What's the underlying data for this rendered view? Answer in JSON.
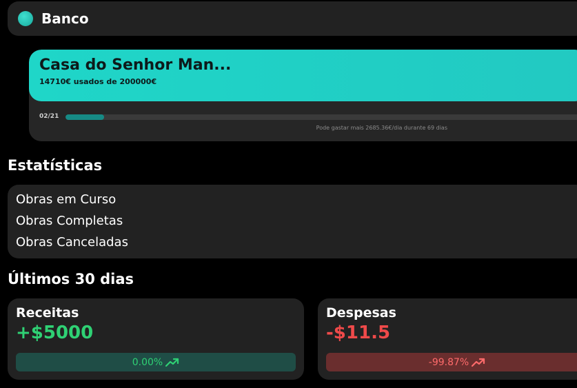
{
  "bank": {
    "name": "Banco",
    "dot_color": "#1fb8ab"
  },
  "project": {
    "title": "Casa do Senhor Man...",
    "usage": "14710€ usados de 200000€",
    "date": "02/21",
    "progress": 0.0736,
    "hint": "Pode gastar mais 2685.36€/dia durante 69 dias"
  },
  "stats": {
    "title": "Estatísticas",
    "items": [
      "Obras em Curso",
      "Obras Completas",
      "Obras Canceladas"
    ]
  },
  "last30": {
    "title": "Últimos 30 dias",
    "income": {
      "label": "Receitas",
      "value": "+$5000",
      "change": "0.00%",
      "color": "#2fd174"
    },
    "expense": {
      "label": "Despesas",
      "value": "-$11.5",
      "change": "-99.87%",
      "color": "#ef4a4a"
    }
  }
}
